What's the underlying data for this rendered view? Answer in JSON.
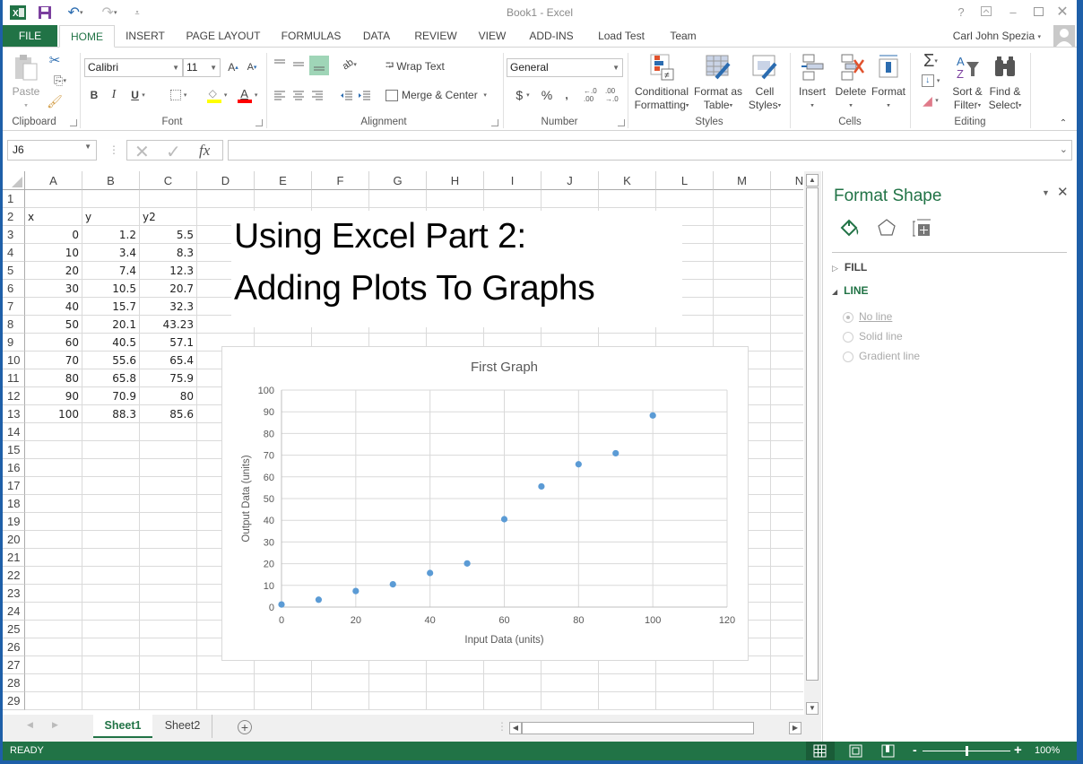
{
  "window": {
    "title": "Book1 - Excel",
    "user_name": "Carl John Spezia",
    "help_label": "?",
    "controls": [
      "help",
      "ribbon-display-options",
      "minimize",
      "maximize",
      "close"
    ]
  },
  "quick_access": [
    "save",
    "undo",
    "redo",
    "customize"
  ],
  "tabs": [
    {
      "label": "FILE"
    },
    {
      "label": "HOME",
      "active": true
    },
    {
      "label": "INSERT"
    },
    {
      "label": "PAGE LAYOUT"
    },
    {
      "label": "FORMULAS"
    },
    {
      "label": "DATA"
    },
    {
      "label": "REVIEW"
    },
    {
      "label": "VIEW"
    },
    {
      "label": "ADD-INS"
    },
    {
      "label": "Load Test"
    },
    {
      "label": "Team"
    }
  ],
  "ribbon": {
    "clipboard": {
      "label": "Clipboard",
      "paste": "Paste"
    },
    "font": {
      "label": "Font",
      "font_name": "Calibri",
      "font_size": "11",
      "bold": "B",
      "italic": "I",
      "underline": "U",
      "fill_color": "#ffff00",
      "font_color": "#ff0000"
    },
    "alignment": {
      "label": "Alignment",
      "wrap_text": "Wrap Text",
      "merge_center": "Merge & Center"
    },
    "number": {
      "label": "Number",
      "format": "General",
      "currency": "$",
      "percent": "%",
      "comma": ",",
      "inc_decimal": "←.0 .00",
      "dec_decimal": ".00 →.0"
    },
    "styles": {
      "label": "Styles",
      "conditional_1": "Conditional",
      "conditional_2": "Formatting",
      "format_table_1": "Format as",
      "format_table_2": "Table",
      "cell_styles_1": "Cell",
      "cell_styles_2": "Styles"
    },
    "cells": {
      "label": "Cells",
      "insert": "Insert",
      "delete": "Delete",
      "format": "Format"
    },
    "editing": {
      "label": "Editing",
      "sort_1": "Sort &",
      "sort_2": "Filter",
      "find_1": "Find &",
      "find_2": "Select",
      "autosum": "Σ"
    }
  },
  "formula_bar": {
    "name_box": "J6",
    "fx_label": "fx",
    "formula": ""
  },
  "grid": {
    "columns": [
      "A",
      "B",
      "C",
      "D",
      "E",
      "F",
      "G",
      "H",
      "I",
      "J",
      "K",
      "L",
      "M",
      "N"
    ],
    "rows": [
      "1",
      "2",
      "3",
      "4",
      "5",
      "6",
      "7",
      "8",
      "9",
      "10",
      "11",
      "12",
      "13",
      "14",
      "15",
      "16",
      "17",
      "18",
      "19",
      "20",
      "21",
      "22",
      "23",
      "24",
      "25",
      "26",
      "27",
      "28",
      "29"
    ],
    "headers": {
      "x": "x",
      "y": "y",
      "y2": "y2"
    },
    "data": [
      {
        "x": "0",
        "y": "1.2",
        "y2": "5.5"
      },
      {
        "x": "10",
        "y": "3.4",
        "y2": "8.3"
      },
      {
        "x": "20",
        "y": "7.4",
        "y2": "12.3"
      },
      {
        "x": "30",
        "y": "10.5",
        "y2": "20.7"
      },
      {
        "x": "40",
        "y": "15.7",
        "y2": "32.3"
      },
      {
        "x": "50",
        "y": "20.1",
        "y2": "43.23"
      },
      {
        "x": "60",
        "y": "40.5",
        "y2": "57.1"
      },
      {
        "x": "70",
        "y": "55.6",
        "y2": "65.4"
      },
      {
        "x": "80",
        "y": "65.8",
        "y2": "75.9"
      },
      {
        "x": "90",
        "y": "70.9",
        "y2": "80"
      },
      {
        "x": "100",
        "y": "88.3",
        "y2": "85.6"
      }
    ]
  },
  "textbox": {
    "line1": "Using Excel Part 2:",
    "line2": "Adding Plots To Graphs"
  },
  "chart_data": {
    "type": "scatter",
    "title": "First Graph",
    "xlabel": "Input Data (units)",
    "ylabel": "Output Data (units)",
    "xlim": [
      0,
      120
    ],
    "ylim": [
      0,
      100
    ],
    "xticks": [
      0,
      20,
      40,
      60,
      80,
      100,
      120
    ],
    "yticks": [
      0,
      10,
      20,
      30,
      40,
      50,
      60,
      70,
      80,
      90,
      100
    ],
    "grid": true,
    "legend": "none",
    "series": [
      {
        "name": "y",
        "color": "#5b9bd5",
        "x": [
          0,
          10,
          20,
          30,
          40,
          50,
          60,
          70,
          80,
          90,
          100
        ],
        "y": [
          1.2,
          3.4,
          7.4,
          10.5,
          15.7,
          20.1,
          40.5,
          55.6,
          65.8,
          70.9,
          88.3
        ]
      }
    ]
  },
  "sheet_tabs": [
    {
      "label": "Sheet1",
      "active": true
    },
    {
      "label": "Sheet2"
    }
  ],
  "format_pane": {
    "title": "Format Shape",
    "sections": [
      {
        "label": "FILL",
        "expanded": false
      },
      {
        "label": "LINE",
        "expanded": true
      }
    ],
    "line_options": [
      {
        "label": "No line",
        "selected": true
      },
      {
        "label": "Solid line",
        "selected": false
      },
      {
        "label": "Gradient line",
        "selected": false
      }
    ]
  },
  "status_bar": {
    "mode": "READY",
    "zoom": "100%",
    "zoom_fraction": 0.5
  },
  "colors": {
    "accent": "#217346",
    "series": "#5b9bd5"
  }
}
